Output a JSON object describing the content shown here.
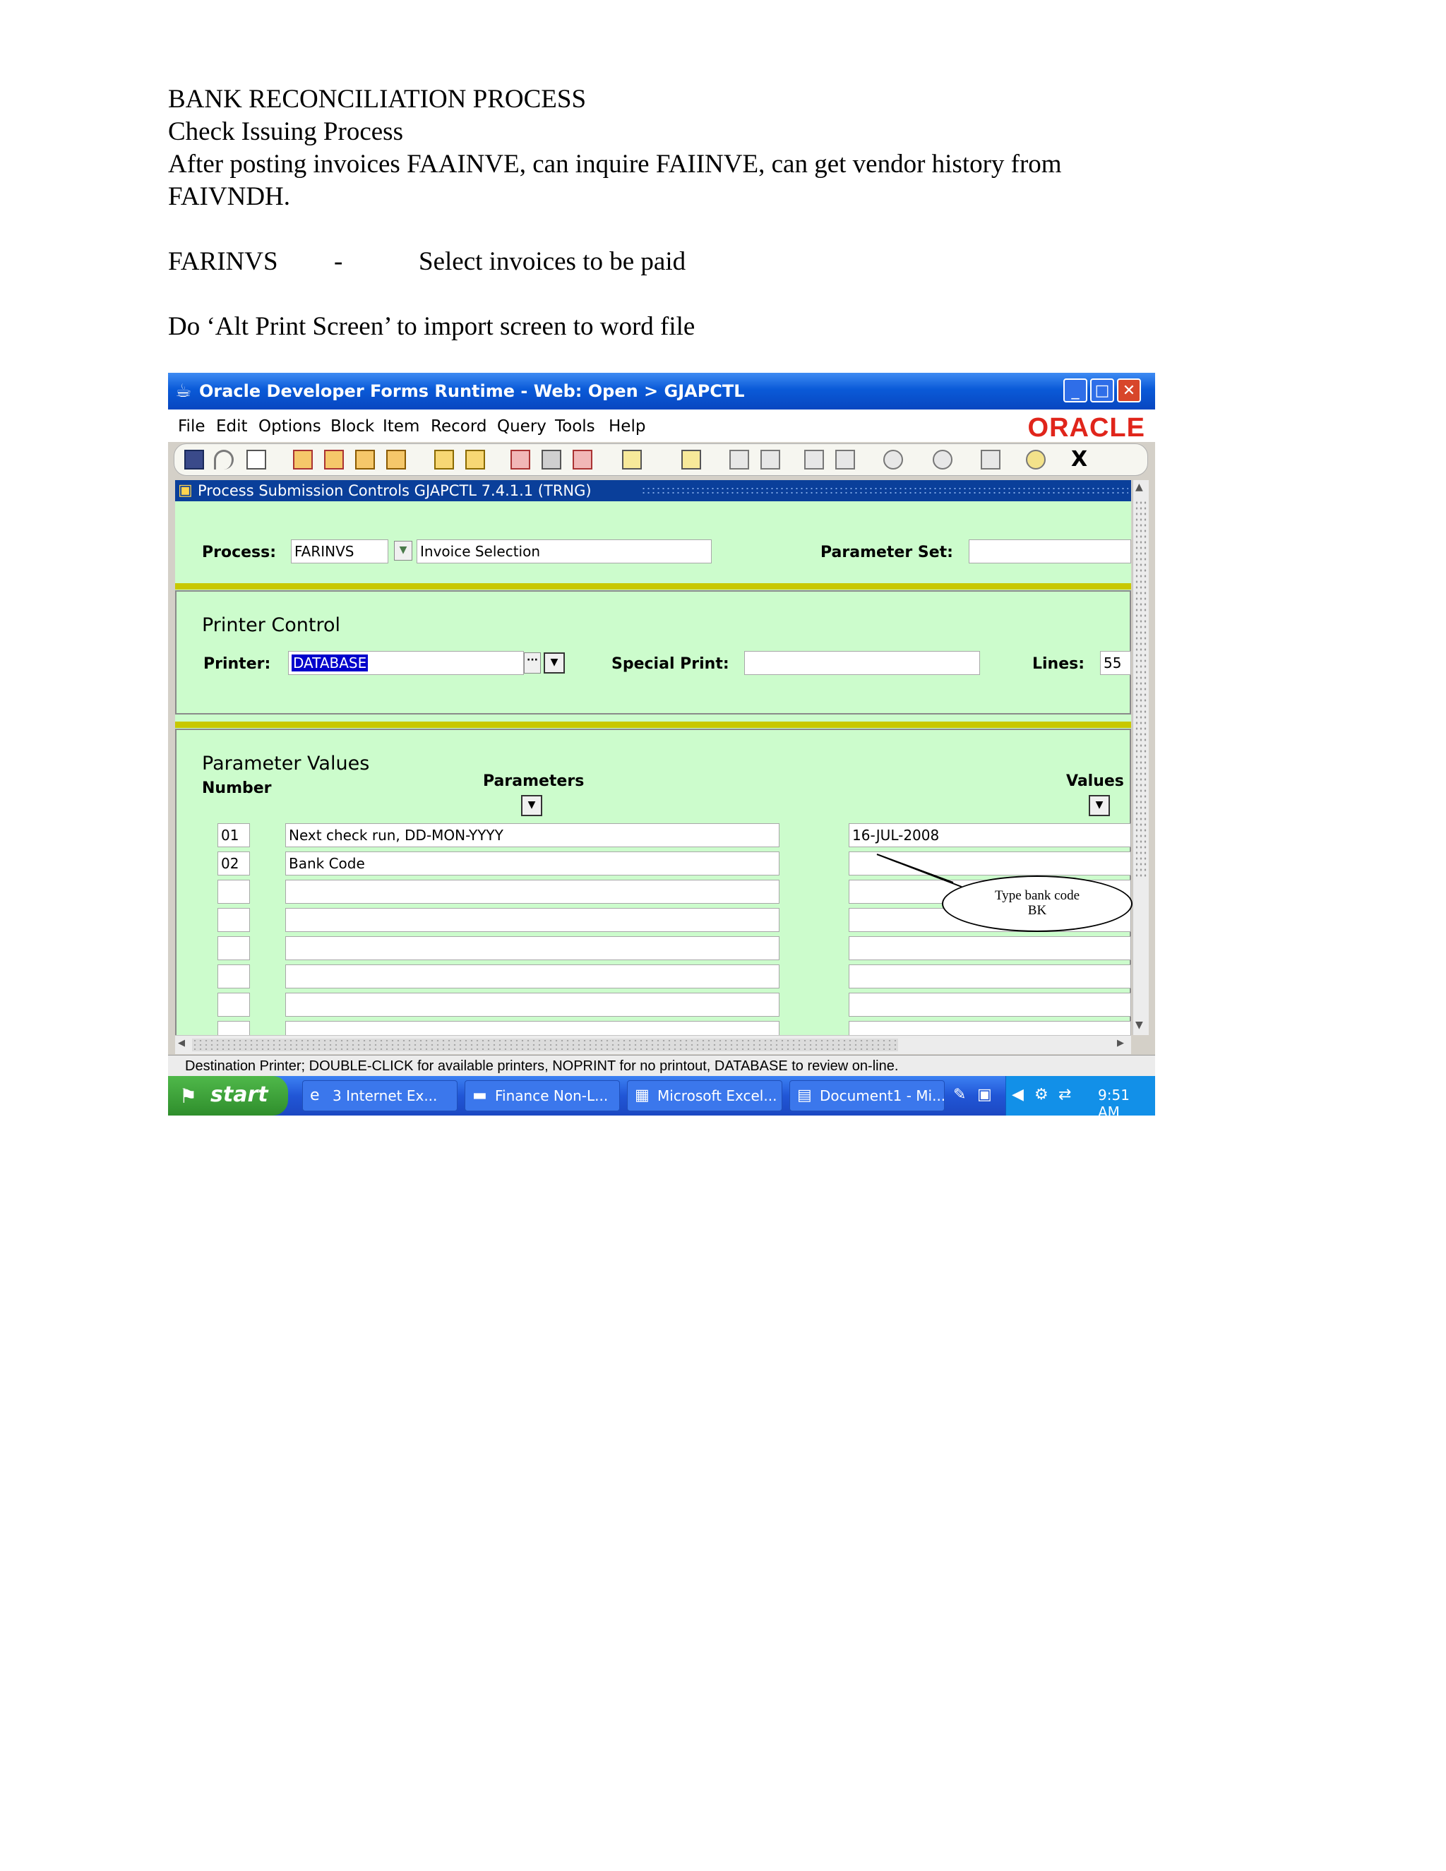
{
  "document": {
    "heading": "BANK RECONCILIATION PROCESS",
    "subheading": "Check Issuing Process",
    "intro_line1": "After posting invoices FAAINVE, can inquire FAIINVE, can get vendor history from",
    "intro_line2": "FAIVNDH.",
    "farinvs_code": "FARINVS",
    "farinvs_dash": "-",
    "farinvs_desc": "Select invoices to be paid",
    "instruction": "Do ‘Alt Print Screen’ to import screen to word file"
  },
  "window": {
    "title": "Oracle Developer Forms Runtime - Web:  Open > GJAPCTL",
    "brand": "ORACLE",
    "menu": [
      "File",
      "Edit",
      "Options",
      "Block",
      "Item",
      "Record",
      "Query",
      "Tools",
      "Help"
    ],
    "toolbar_exit": "X"
  },
  "form": {
    "title": "Process Submission Controls  GJAPCTL  7.4.1.1  (TRNG)",
    "process_label": "Process:",
    "process_code": "FARINVS",
    "process_name": "Invoice Selection",
    "parameter_set_label": "Parameter Set:",
    "parameter_set_value": "",
    "printer_control_heading": "Printer Control",
    "printer_label": "Printer:",
    "printer_value": "DATABASE",
    "special_print_label": "Special Print:",
    "special_print_value": "",
    "lines_label": "Lines:",
    "lines_value": "55",
    "parameter_values_heading": "Parameter Values",
    "col_number": "Number",
    "col_parameters": "Parameters",
    "col_values": "Values",
    "rows": [
      {
        "number": "01",
        "parameter": "Next check run, DD-MON-YYYY",
        "value": "16-JUL-2008"
      },
      {
        "number": "02",
        "parameter": "Bank Code",
        "value": ""
      },
      {
        "number": "",
        "parameter": "",
        "value": ""
      },
      {
        "number": "",
        "parameter": "",
        "value": ""
      },
      {
        "number": "",
        "parameter": "",
        "value": ""
      },
      {
        "number": "",
        "parameter": "",
        "value": ""
      },
      {
        "number": "",
        "parameter": "",
        "value": ""
      },
      {
        "number": "",
        "parameter": "",
        "value": ""
      }
    ]
  },
  "callout": {
    "line1": "Type bank code",
    "line2": "BK"
  },
  "status": "Destination Printer; DOUBLE-CLICK for available printers, NOPRINT for no printout, DATABASE to review on-line.",
  "taskbar": {
    "start": "start",
    "tasks": [
      "3 Internet Ex...",
      "Finance Non-L...",
      "Microsoft Excel...",
      "Document1 - Mi..."
    ],
    "clock": "9:51 AM"
  },
  "colors": {
    "form_bg": "#ccfccc",
    "separator": "#c8c800",
    "title_bar": "#0a5ad8",
    "brand": "#e0251b"
  }
}
